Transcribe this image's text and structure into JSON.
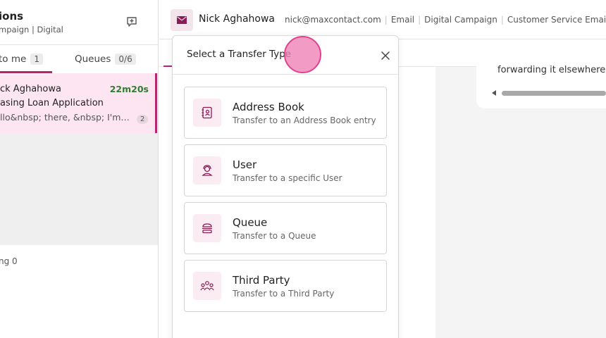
{
  "left_panel": {
    "title": "ions",
    "subtitle": "mpaign | Digital",
    "tabs": {
      "assigned_label": "to me",
      "assigned_count": "1",
      "queues_label": "Queues",
      "queues_count": "0/6"
    },
    "conversation": {
      "name": "ck Aghahowa",
      "time": "22m20s",
      "subject": "asing Loan Application",
      "preview": "llo&nbsp; there, &nbsp; I'm ...",
      "badge": "2"
    },
    "footer": "ng 0"
  },
  "header": {
    "contact_name": "Nick Aghahowa",
    "email": "nick@maxcontact.com",
    "channel": "Email",
    "campaign": "Digital Campaign",
    "team": "Customer Service Email"
  },
  "conversation_message": {
    "text": "forwarding it elsewhere."
  },
  "modal": {
    "title": "Select a Transfer Type",
    "options": [
      {
        "title": "Address Book",
        "description": "Transfer to an Address Book entry",
        "icon": "address-book-icon"
      },
      {
        "title": "User",
        "description": "Transfer to a specific User",
        "icon": "user-icon"
      },
      {
        "title": "Queue",
        "description": "Transfer to a Queue",
        "icon": "queue-icon"
      },
      {
        "title": "Third Party",
        "description": "Transfer to a Third Party",
        "icon": "third-party-icon"
      }
    ]
  },
  "colors": {
    "accent": "#b5266f",
    "card_highlight": "#fde6f1",
    "timer_green": "#2e7d32",
    "icon_bg": "#fbecf3",
    "cursor": "#ee82b7"
  }
}
